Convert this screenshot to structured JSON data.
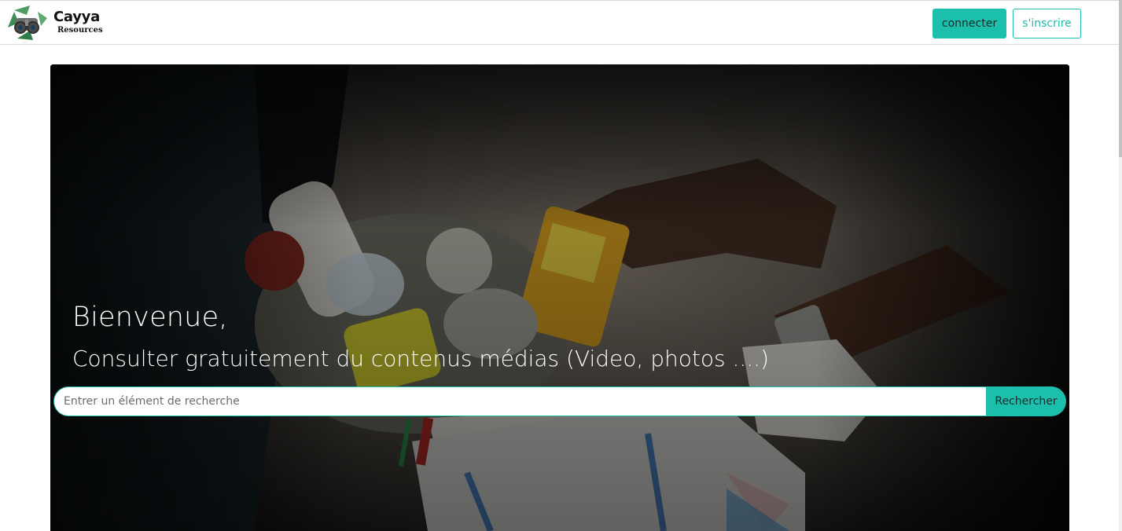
{
  "brand": {
    "name": "Cayya",
    "tagline": "Resources",
    "logo_icon": "recycle-binoculars-icon"
  },
  "nav": {
    "login_label": "connecter",
    "signup_label": "s'inscrire"
  },
  "hero": {
    "title": "Bienvenue,",
    "subtitle": "Consulter gratuitement du contenus médias (Video, photos ....)",
    "image": "hands-collecting-plastic-waste-photo"
  },
  "search": {
    "placeholder": "Entrer un élément de recherche",
    "value": "",
    "button_label": "Rechercher"
  },
  "colors": {
    "accent": "#1bbfab",
    "hero_overlay": "#000000"
  }
}
